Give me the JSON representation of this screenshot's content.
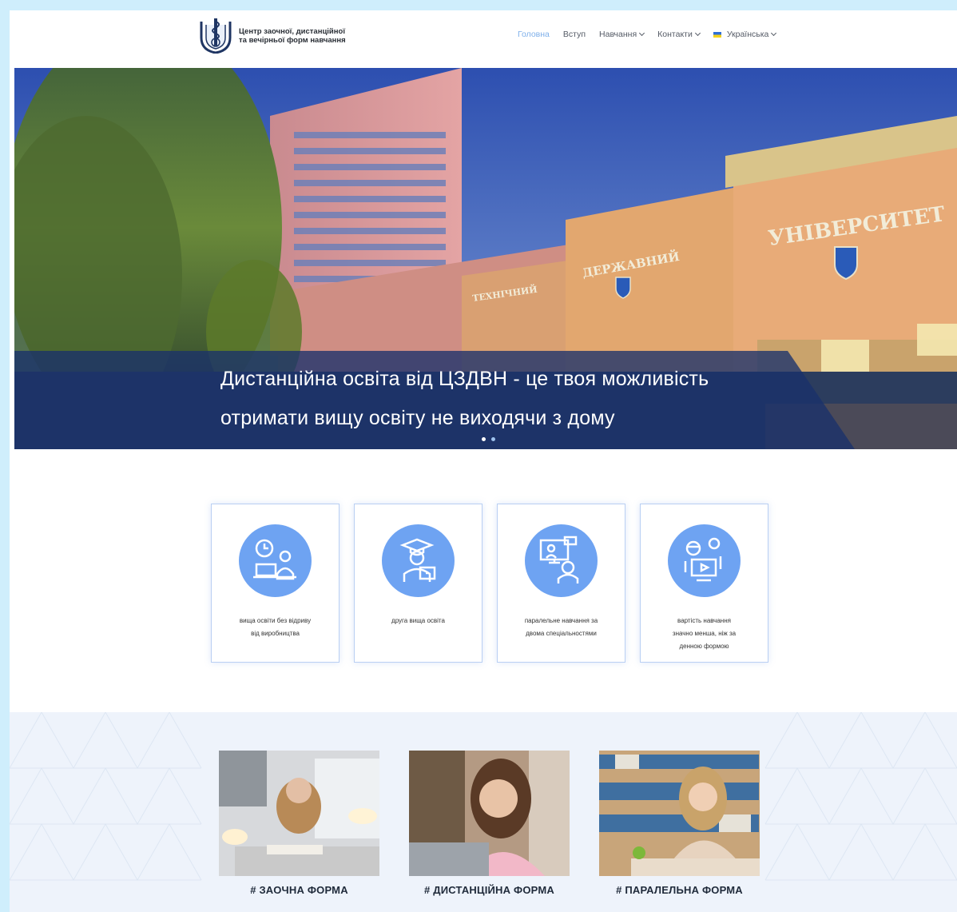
{
  "header": {
    "logo_alt": "university-logo",
    "logo_title_line1": "Центр заочної, дистанційної",
    "logo_title_line2": "та вечірньої форм навчання",
    "nav": [
      {
        "label": "Головна",
        "active": true,
        "dropdown": false
      },
      {
        "label": "Вступ",
        "active": false,
        "dropdown": false
      },
      {
        "label": "Навчання",
        "active": false,
        "dropdown": true
      },
      {
        "label": "Контакти",
        "active": false,
        "dropdown": true
      },
      {
        "label": "Українська",
        "active": false,
        "dropdown": true,
        "flag": "ukraine-flag-icon"
      }
    ]
  },
  "hero": {
    "caption_line1": "Дистанційна освіта від ЦЗДВН - це твоя можливість",
    "caption_line2": "отримати вищу освіту не виходячи з дому",
    "sign_main": "УНІВЕРСИТЕТ",
    "sign_second": "ДЕРЖАВНИЙ",
    "sign_first": "ТЕХНІЧНИЙ",
    "slides_total": 2,
    "slide_active": 1
  },
  "features": [
    {
      "icon": "clock-laptop-icon",
      "label_line1": "вища освіти без відриву",
      "label_line2": "від виробництва",
      "label_line3": ""
    },
    {
      "icon": "graduate-laptop-icon",
      "label_line1": "друга вища освіта",
      "label_line2": "",
      "label_line3": ""
    },
    {
      "icon": "online-teacher-icon",
      "label_line1": "паралельне навчання за",
      "label_line2": "двома спеціальностями",
      "label_line3": ""
    },
    {
      "icon": "video-learning-icon",
      "label_line1": "вартість навчання",
      "label_line2": "значно менша, ніж за",
      "label_line3": "денною формою"
    }
  ],
  "study_forms": [
    {
      "label": "# ЗАОЧНА ФОРМА",
      "photo": "student-reading-lamp-photo"
    },
    {
      "label": "# ДИСТАНЦІЙНА ФОРМА",
      "photo": "student-smiling-laptop-photo"
    },
    {
      "label": "# ПАРАЛЕЛЬНА ФОРМА",
      "photo": "student-library-photo"
    }
  ],
  "colors": {
    "background": "#cfeefc",
    "accent": "#6ea3f2",
    "nav_active": "#7fb0ea",
    "caption_bg": "#1a316c",
    "section_bg": "#eef3fb"
  }
}
